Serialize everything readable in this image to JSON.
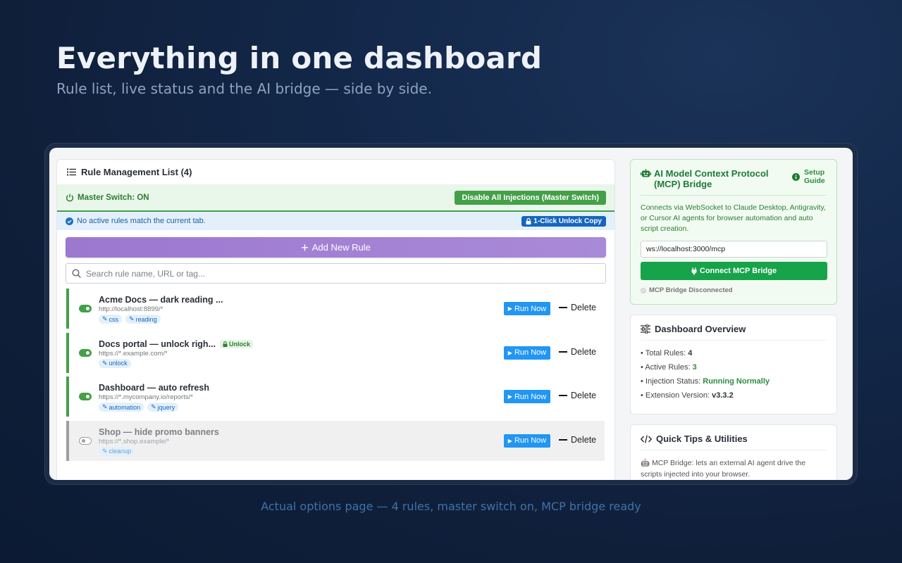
{
  "hero": {
    "title": "Everything in one dashboard",
    "subtitle": "Rule list, live status and the AI bridge — side by side."
  },
  "caption": "Actual options page — 4 rules, master switch on, MCP bridge ready",
  "rule_panel": {
    "title": "Rule Management List (4)",
    "master_label": "Master Switch: ON",
    "master_button": "Disable All Injections (Master Switch)",
    "info_text": "No active rules match the current tab.",
    "unlock_button": "1-Click Unlock Copy",
    "add_button": "Add New Rule",
    "search_placeholder": "Search rule name, URL or tag...",
    "run_label": "Run Now",
    "delete_label": "Delete",
    "rules": [
      {
        "name": "Acme Docs — dark reading ...",
        "url": "http://localhost:8899/*",
        "tags": [
          "css",
          "reading"
        ],
        "enabled": true,
        "badge": ""
      },
      {
        "name": "Docs portal — unlock righ...",
        "url": "https://*.example.com/*",
        "tags": [
          "unlock"
        ],
        "enabled": true,
        "badge": "Unlock"
      },
      {
        "name": "Dashboard — auto refresh",
        "url": "https://*.mycompany.io/reports/*",
        "tags": [
          "automation",
          "jquery"
        ],
        "enabled": true,
        "badge": ""
      },
      {
        "name": "Shop — hide promo banners",
        "url": "https://*.shop.example/*",
        "tags": [
          "cleanup"
        ],
        "enabled": false,
        "badge": ""
      }
    ]
  },
  "mcp": {
    "title": "AI Model Context Protocol (MCP) Bridge",
    "guide": "Setup Guide",
    "description": "Connects via WebSocket to Claude Desktop, Antigravity, or Cursor AI agents for browser automation and auto script creation.",
    "ws_value": "ws://localhost:3000/mcp",
    "connect_button": "Connect MCP Bridge",
    "status": "MCP Bridge Disconnected"
  },
  "overview": {
    "title": "Dashboard Overview",
    "total_label": "Total Rules:",
    "total_value": "4",
    "active_label": "Active Rules:",
    "active_value": "3",
    "injection_label": "Injection Status:",
    "injection_value": "Running Normally",
    "version_label": "Extension Version:",
    "version_value": "v3.3.2"
  },
  "tips": {
    "title": "Quick Tips & Utilities",
    "text": "🤖 MCP Bridge: lets an external AI agent drive the scripts injected into your browser."
  },
  "colors": {
    "success": "#43a047",
    "primary": "#2196f3",
    "accent_purple": "#9c78cf",
    "mcp_green": "#17a34a"
  }
}
